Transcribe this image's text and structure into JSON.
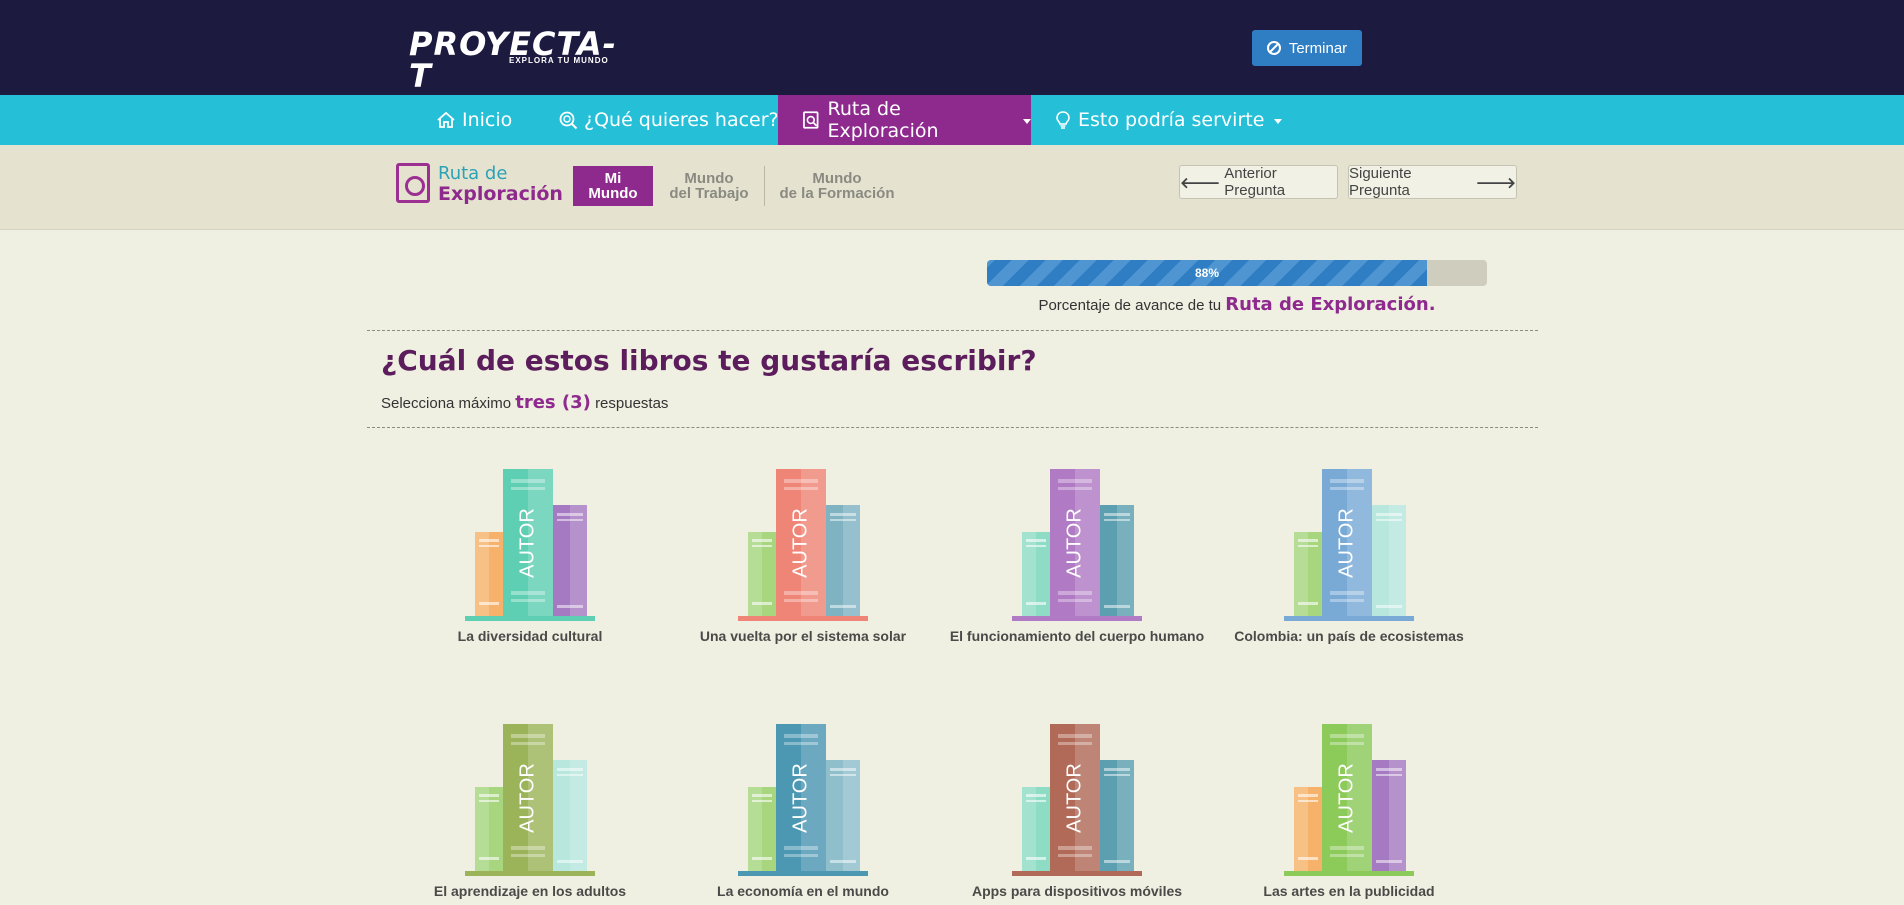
{
  "header": {
    "logo_text": "PROYECTA-T",
    "logo_tagline": "EXPLORA TU MUNDO",
    "finish_button": "Terminar"
  },
  "nav": {
    "items": [
      {
        "label": "Inicio",
        "icon": "home-icon"
      },
      {
        "label": "¿Qué quieres hacer?",
        "icon": "search-icon"
      },
      {
        "label": "Ruta de Exploración",
        "icon": "route-icon"
      },
      {
        "label": "Esto podría servirte",
        "icon": "lightbulb-icon"
      }
    ]
  },
  "route": {
    "title_line1": "Ruta de",
    "title_line2": "Exploración",
    "steps": [
      {
        "line1": "Mi",
        "line2": "Mundo"
      },
      {
        "line1": "Mundo",
        "line2": "del Trabajo"
      },
      {
        "line1": "Mundo",
        "line2": "de la Formación"
      }
    ],
    "prev_button": "Anterior Pregunta",
    "next_button": "Siguiente Pregunta"
  },
  "progress": {
    "value": 88,
    "value_label": "88%",
    "caption_prefix": "Porcentaje de avance de tu",
    "caption_highlight": "Ruta de Exploración."
  },
  "question": {
    "title": "¿Cuál de estos libros te gustaría escribir?",
    "hint_prefix": "Selecciona máximo",
    "hint_highlight": "tres (3)",
    "hint_suffix": "respuestas"
  },
  "book_spine_text": "AUTOR",
  "options": [
    {
      "label": "La diversidad cultural",
      "colors": [
        "#f6b26b",
        "#5fcfb3",
        "#a67ac2"
      ],
      "base": "#5fcfb3"
    },
    {
      "label": "Una vuelta por el sistema solar",
      "colors": [
        "#a7d67f",
        "#ee8577",
        "#7fb3c2"
      ],
      "base": "#ee8577"
    },
    {
      "label": "El funcionamiento del cuerpo humano",
      "colors": [
        "#8fdcc5",
        "#b07ac4",
        "#5c9fb0"
      ],
      "base": "#b07ac4"
    },
    {
      "label": "Colombia: un país de ecosistemas",
      "colors": [
        "#a7d67f",
        "#79aad6",
        "#b8e7dd"
      ],
      "base": "#79aad6"
    },
    {
      "label": "El aprendizaje en los adultos",
      "colors": [
        "#a7d67f",
        "#9bb45a",
        "#b8e7dd"
      ],
      "base": "#9bb45a"
    },
    {
      "label": "La economía en el mundo",
      "colors": [
        "#a7d67f",
        "#4c97b2",
        "#8fbfcb"
      ],
      "base": "#4c97b2"
    },
    {
      "label": "Apps para dispositivos móviles",
      "colors": [
        "#8fdcc5",
        "#b06a57",
        "#5c9fb0"
      ],
      "base": "#b06a57"
    },
    {
      "label": "Las artes en la publicidad",
      "colors": [
        "#f6b26b",
        "#8cca5a",
        "#a67ac2"
      ],
      "base": "#8cca5a"
    }
  ]
}
